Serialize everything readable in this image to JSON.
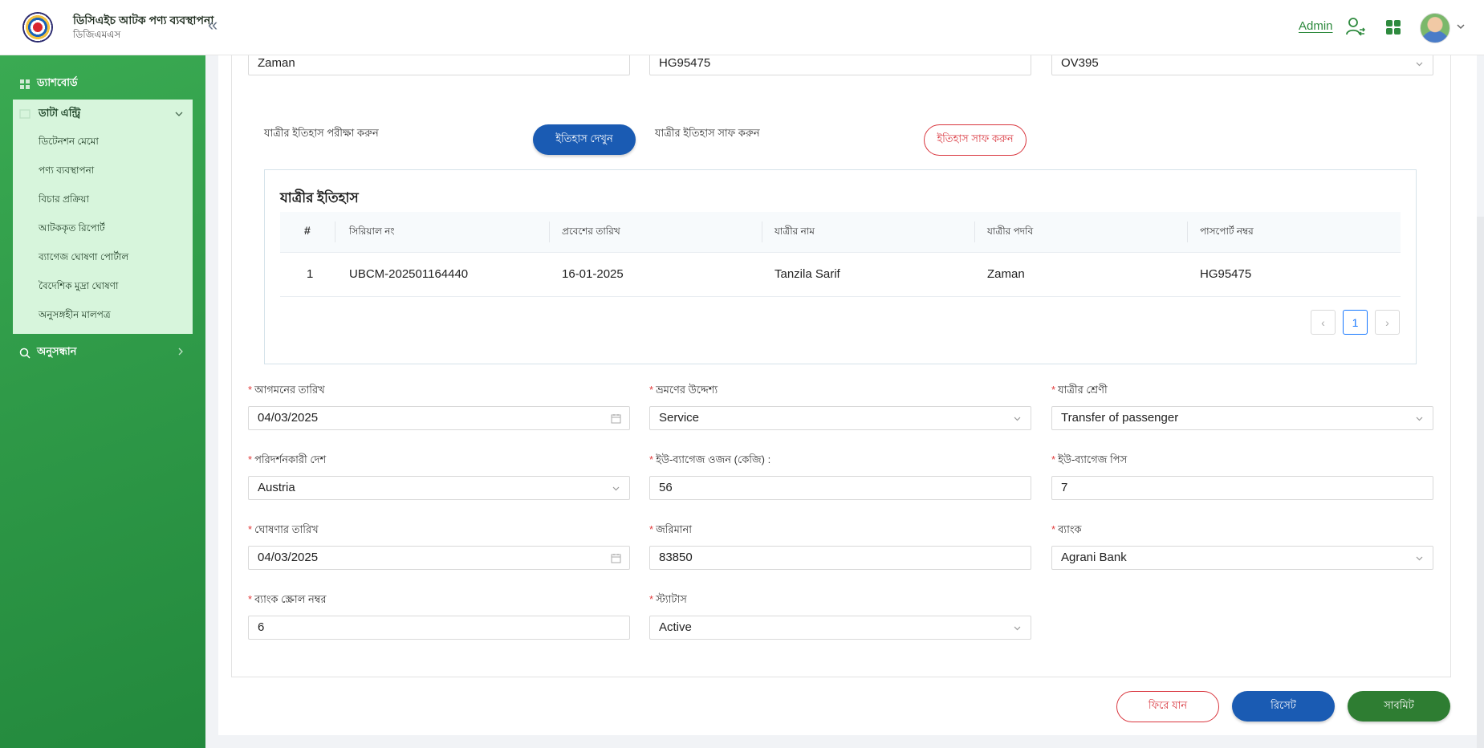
{
  "header": {
    "app_title": "ডিসিএইচ আটক পণ্য ব্যবস্থাপনা",
    "app_subtitle": "ডিজিএমএস",
    "collapse_glyph": "«",
    "admin_label": "Admin"
  },
  "sidebar": {
    "dashboard": "ড্যাশবোর্ড",
    "data_entry": "ডাটা এন্ট্রি",
    "submenu": [
      "ডিটেনশন মেমো",
      "পণ্য ব্যবস্থাপনা",
      "বিচার প্রক্রিয়া",
      "আটককৃত রিপোর্ট",
      "ব্যাগেজ ঘোষণা পোর্টাল",
      "বৈদেশিক মুদ্রা ঘোষণা",
      "অনুসঙ্গহীন মালপত্র"
    ],
    "search": "অনুসন্ধান"
  },
  "top_fields": {
    "designation_value": "Zaman",
    "passport_value": "HG95475",
    "flight_value": "OV395"
  },
  "history_controls": {
    "check_label": "যাত্রীর ইতিহাস পরীক্ষা করুন",
    "view_button": "ইতিহাস দেখুন",
    "clear_label": "যাত্রীর ইতিহাস সাফ করুন",
    "clear_button": "ইতিহাস সাফ করুন"
  },
  "history": {
    "title": "যাত্রীর ইতিহাস",
    "columns": [
      "#",
      "সিরিয়াল নং",
      "প্রবেশের তারিখ",
      "যাত্রীর নাম",
      "যাত্রীর পদবি",
      "পাসপোর্ট নম্বর"
    ],
    "rows": [
      [
        "1",
        "UBCM-202501164440",
        "16-01-2025",
        "Tanzila Sarif",
        "Zaman",
        "HG95475"
      ]
    ],
    "pager": {
      "prev": "‹",
      "current": "1",
      "next": "›"
    }
  },
  "form": {
    "arrival_date": {
      "label": "আগমনের তারিখ",
      "value": "04/03/2025"
    },
    "travel_purpose": {
      "label": "ভ্রমণের উদ্দেশ্য",
      "value": "Service"
    },
    "passenger_category": {
      "label": "যাত্রীর শ্রেণী",
      "value": "Transfer of passenger"
    },
    "visited_country": {
      "label": "পরিদর্শনকারী দেশ",
      "value": "Austria"
    },
    "u_baggage_weight": {
      "label": "ইউ-ব্যাগেজ ওজন (কেজি) :",
      "value": "56"
    },
    "u_baggage_pieces": {
      "label": "ইউ-ব্যাগেজ পিস",
      "value": "7"
    },
    "declaration_date": {
      "label": "ঘোষণার তারিখ",
      "value": "04/03/2025"
    },
    "fine": {
      "label": "জরিমানা",
      "value": "83850"
    },
    "bank": {
      "label": "ব্যাংক",
      "value": "Agrani Bank"
    },
    "bank_scroll_no": {
      "label": "ব্যাংক স্ক্রোল নম্বর",
      "value": "6"
    },
    "status": {
      "label": "স্ট্যাটাস",
      "value": "Active"
    },
    "required_mark": "*"
  },
  "actions": {
    "back": "ফিরে যান",
    "reset": "রিসেট",
    "submit": "সাবমিট"
  },
  "colors": {
    "sidebar_green": "#2f9a48",
    "primary_blue": "#1a5bb3",
    "danger_red": "#d9363e",
    "submit_green": "#2e7d32"
  }
}
